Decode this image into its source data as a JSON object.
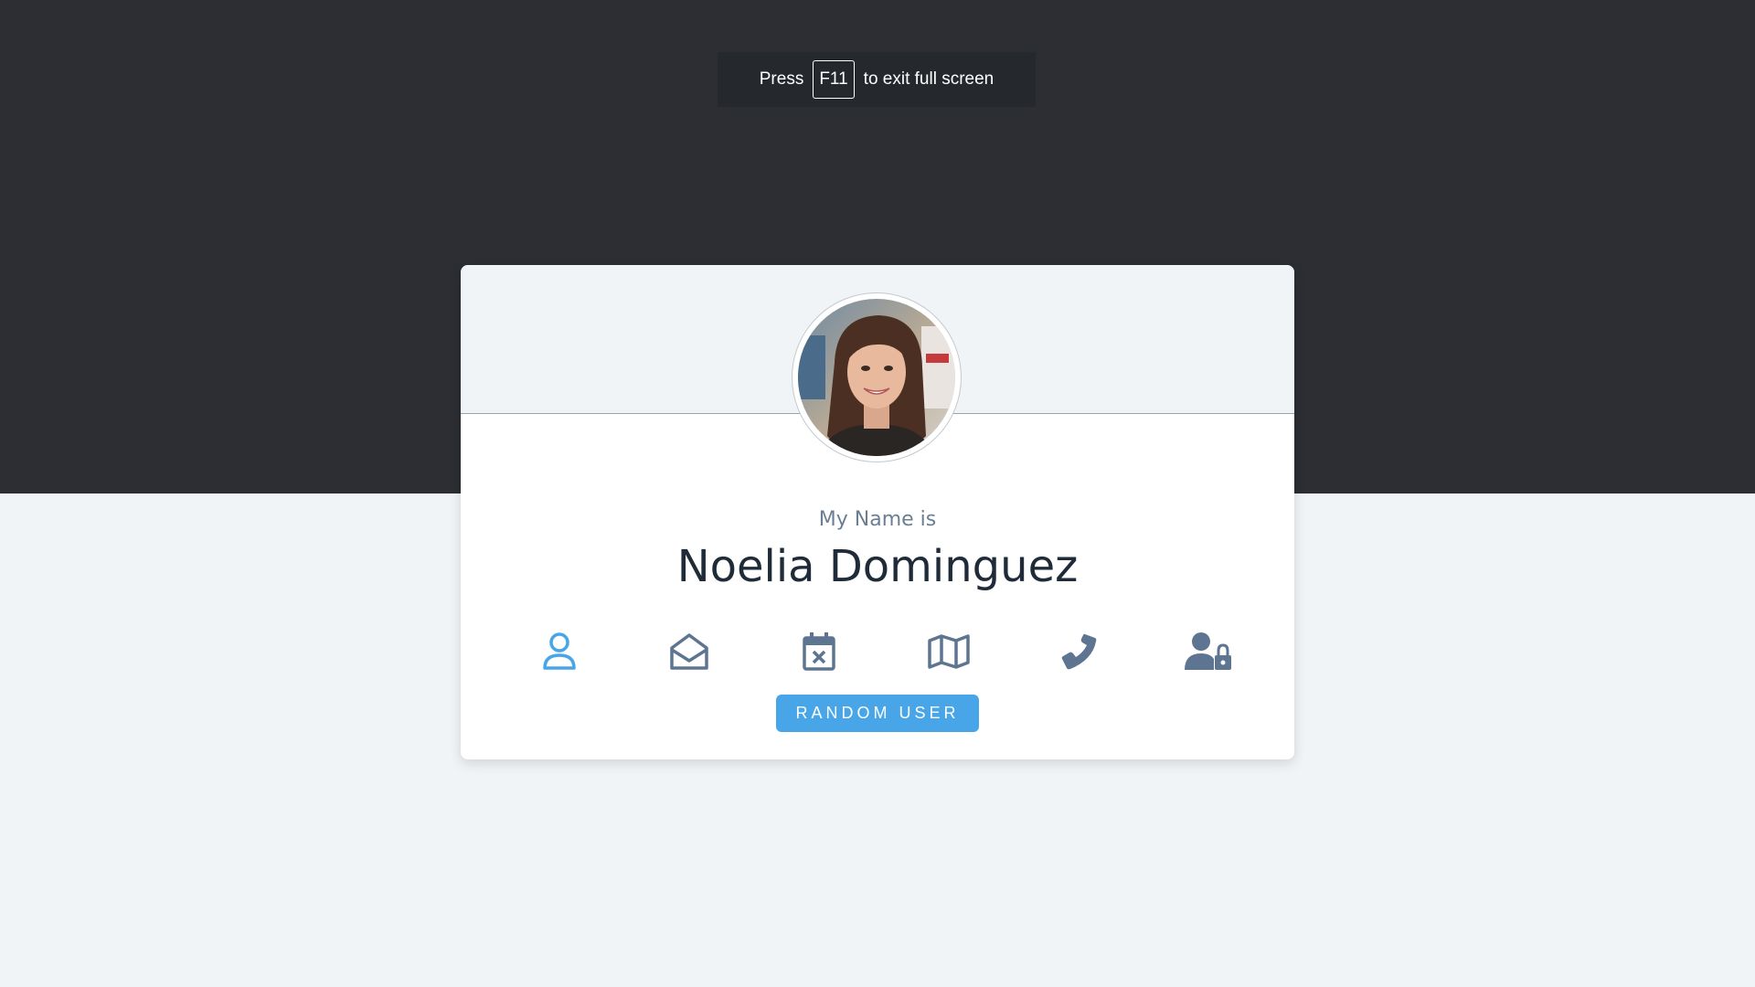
{
  "fullscreen_notice": {
    "press": "Press",
    "key": "F11",
    "rest": "to exit full screen"
  },
  "profile": {
    "title": "My Name is",
    "value": "Noelia Dominguez",
    "active_color": "#48a6e8",
    "icon_color": "#5d7590"
  },
  "icons": [
    {
      "name": "user-icon",
      "active": true
    },
    {
      "name": "envelope-open-icon",
      "active": false
    },
    {
      "name": "calendar-x-icon",
      "active": false
    },
    {
      "name": "map-icon",
      "active": false
    },
    {
      "name": "phone-icon",
      "active": false
    },
    {
      "name": "user-lock-icon",
      "active": false
    }
  ],
  "button": {
    "label": "RANDOM USER"
  }
}
